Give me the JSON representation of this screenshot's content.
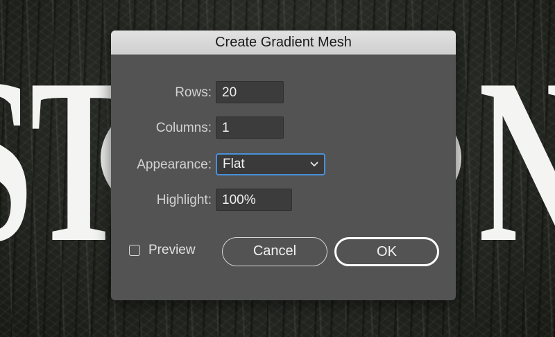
{
  "background": {
    "letters_left": "ST",
    "letters_right": "N"
  },
  "dialog": {
    "title": "Create Gradient Mesh",
    "rows": {
      "label": "Rows:",
      "value": "20"
    },
    "columns": {
      "label": "Columns:",
      "value": "1"
    },
    "appearance": {
      "label": "Appearance:",
      "value": "Flat"
    },
    "highlight": {
      "label": "Highlight:",
      "value": "100%"
    },
    "preview": {
      "label": "Preview",
      "checked": false
    },
    "buttons": {
      "cancel": "Cancel",
      "ok": "OK"
    }
  },
  "colors": {
    "dialog_bg": "#535353",
    "titlebar_bg": "#d8d8d8",
    "focus_ring": "#4a90d9"
  },
  "icons": {
    "select_chevron": "chevron-down-icon",
    "preview_checkbox": "checkbox-icon"
  }
}
